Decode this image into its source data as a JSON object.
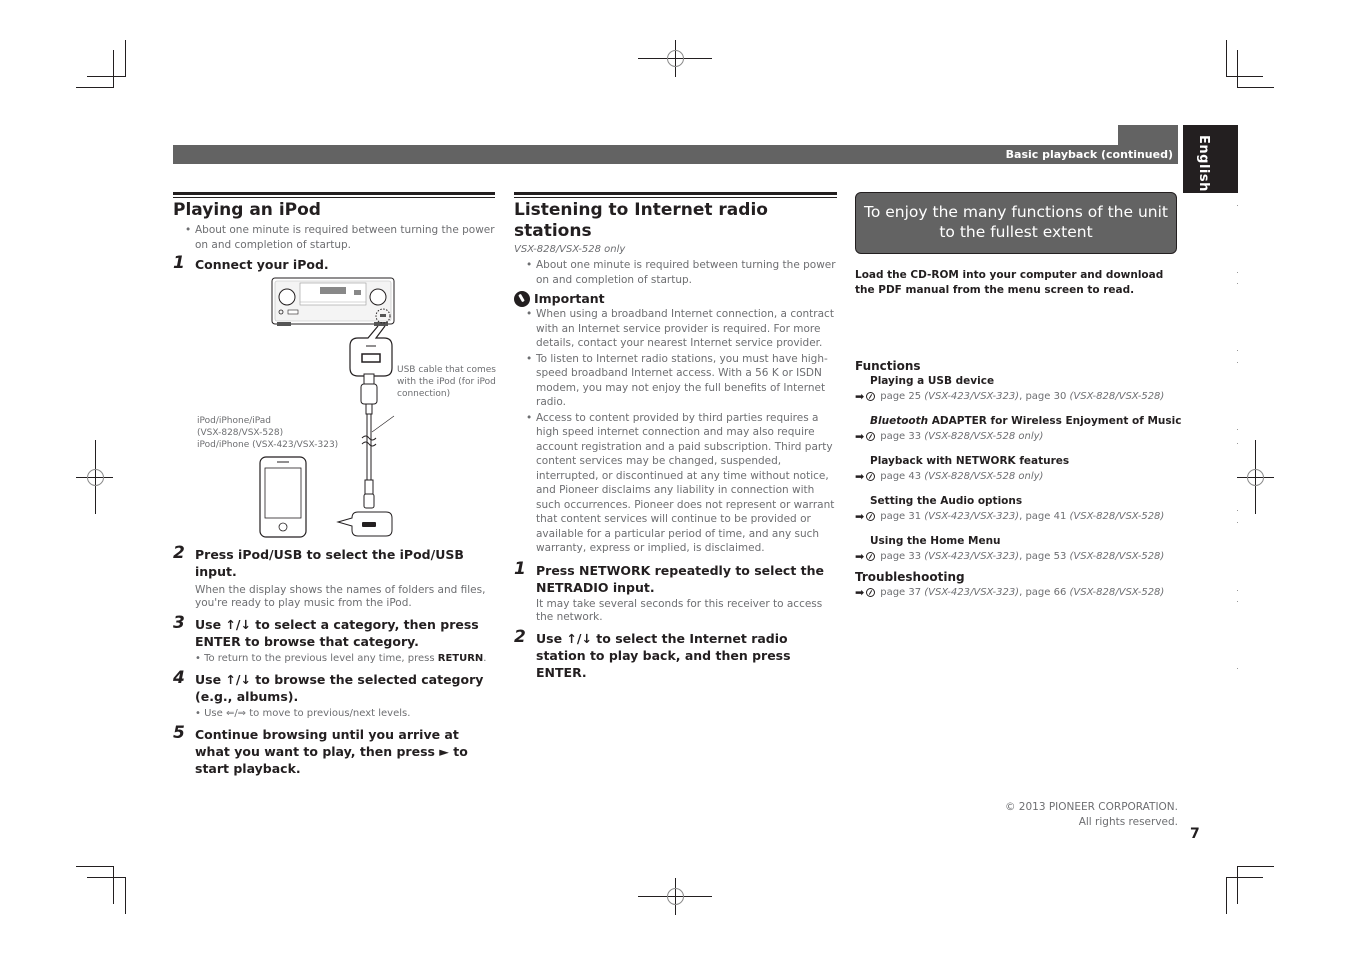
{
  "header": {
    "section_title": "Basic playback (continued)",
    "language_tab": "English"
  },
  "left_column": {
    "title": "Playing an iPod",
    "intro_bullet": "About one minute is required between turning the power on and completion of startup.",
    "steps": [
      {
        "num": "1",
        "text": "Connect your iPod."
      },
      {
        "num": "2",
        "text": "Press iPod/USB to select the iPod/USB input.",
        "desc": "When the display shows the names of folders and files, you're ready to play music from the iPod."
      },
      {
        "num": "3",
        "text": "Use ↑/↓ to select a category, then press ENTER to browse that category.",
        "note_prefix": "• To return to the previous level any time, press ",
        "note_bold": "RETURN",
        "note_suffix": "."
      },
      {
        "num": "4",
        "text": "Use ↑/↓ to browse the selected category (e.g., albums).",
        "note": "• Use ⇐/⇒ to move to previous/next levels."
      },
      {
        "num": "5",
        "text": "Continue browsing until you arrive at what you want to play, then press ► to start playback."
      }
    ],
    "diagram": {
      "cable_label": "USB cable that comes with the iPod (for iPod connection)",
      "device_label_1": "iPod/iPhone/iPad",
      "device_label_2": "(VSX-828/VSX-528)",
      "device_label_3": "iPod/iPhone (VSX-423/VSX-323)"
    }
  },
  "middle_column": {
    "title": "Listening to Internet radio stations",
    "model_note": "VSX-828/VSX-528 only",
    "intro_bullet": "About one minute is required between turning the power on and completion of startup.",
    "important_label": "Important",
    "important_bullets": [
      "When using a broadband Internet connection, a contract with an Internet service provider is required. For more details, contact your nearest Internet service provider.",
      "To listen to Internet radio stations, you must have high-speed broadband Internet access. With a 56 K or ISDN modem, you may not enjoy the full benefits of Internet radio.",
      "Access to content provided by third parties requires a high speed internet connection and may also require account registration and a paid subscription. Third party content services may be changed, suspended, interrupted, or discontinued at any time without notice, and Pioneer disclaims any liability in connection with such occurrences. Pioneer does not represent or warrant that content services will continue to be provided or available for a particular period of time, and any such warranty, express or implied, is disclaimed."
    ],
    "steps": [
      {
        "num": "1",
        "text": "Press NETWORK repeatedly to select the NETRADIO input.",
        "desc": "It may take several seconds for this receiver to access the network."
      },
      {
        "num": "2",
        "text": "Use ↑/↓ to select the Internet radio station to play back, and then press ENTER."
      }
    ]
  },
  "right_column": {
    "callout_title": "To enjoy the many functions of the unit to the fullest extent",
    "load_text": "Load the CD-ROM into your computer and download the PDF manual from the menu screen to read.",
    "functions_heading": "Functions",
    "functions": [
      {
        "title_italic": "",
        "title": "Playing a USB device",
        "ref": [
          {
            "t": "page 25 "
          },
          {
            "i": "(VSX-423/VSX-323)"
          },
          {
            "t": ", page 30 "
          },
          {
            "i": "(VSX-828/VSX-528)"
          }
        ]
      },
      {
        "title_italic": "Bluetooth",
        "title": " ADAPTER for Wireless Enjoyment of Music",
        "ref": [
          {
            "t": "page 33 "
          },
          {
            "i": "(VSX-828/VSX-528 only)"
          }
        ]
      },
      {
        "title_italic": "",
        "title": "Playback with NETWORK features",
        "ref": [
          {
            "t": "page 43 "
          },
          {
            "i": "(VSX-828/VSX-528 only)"
          }
        ]
      },
      {
        "title_italic": "",
        "title": "Setting the Audio options",
        "ref": [
          {
            "t": "page 31 "
          },
          {
            "i": "(VSX-423/VSX-323)"
          },
          {
            "t": ", page 41 "
          },
          {
            "i": "(VSX-828/VSX-528)"
          }
        ]
      },
      {
        "title_italic": "",
        "title": "Using the Home Menu",
        "ref": [
          {
            "t": "page 33 "
          },
          {
            "i": "(VSX-423/VSX-323)"
          },
          {
            "t": ", page 53 "
          },
          {
            "i": "(VSX-828/VSX-528)"
          }
        ]
      }
    ],
    "troubleshooting_heading": "Troubleshooting",
    "troubleshooting_ref": [
      {
        "t": "page 37 "
      },
      {
        "i": "(VSX-423/VSX-323)"
      },
      {
        "t": ", page 66 "
      },
      {
        "i": "(VSX-828/VSX-528)"
      }
    ]
  },
  "footer": {
    "copyright_1": "© 2013 PIONEER CORPORATION.",
    "copyright_2": "All rights reserved.",
    "page_number": "7"
  }
}
